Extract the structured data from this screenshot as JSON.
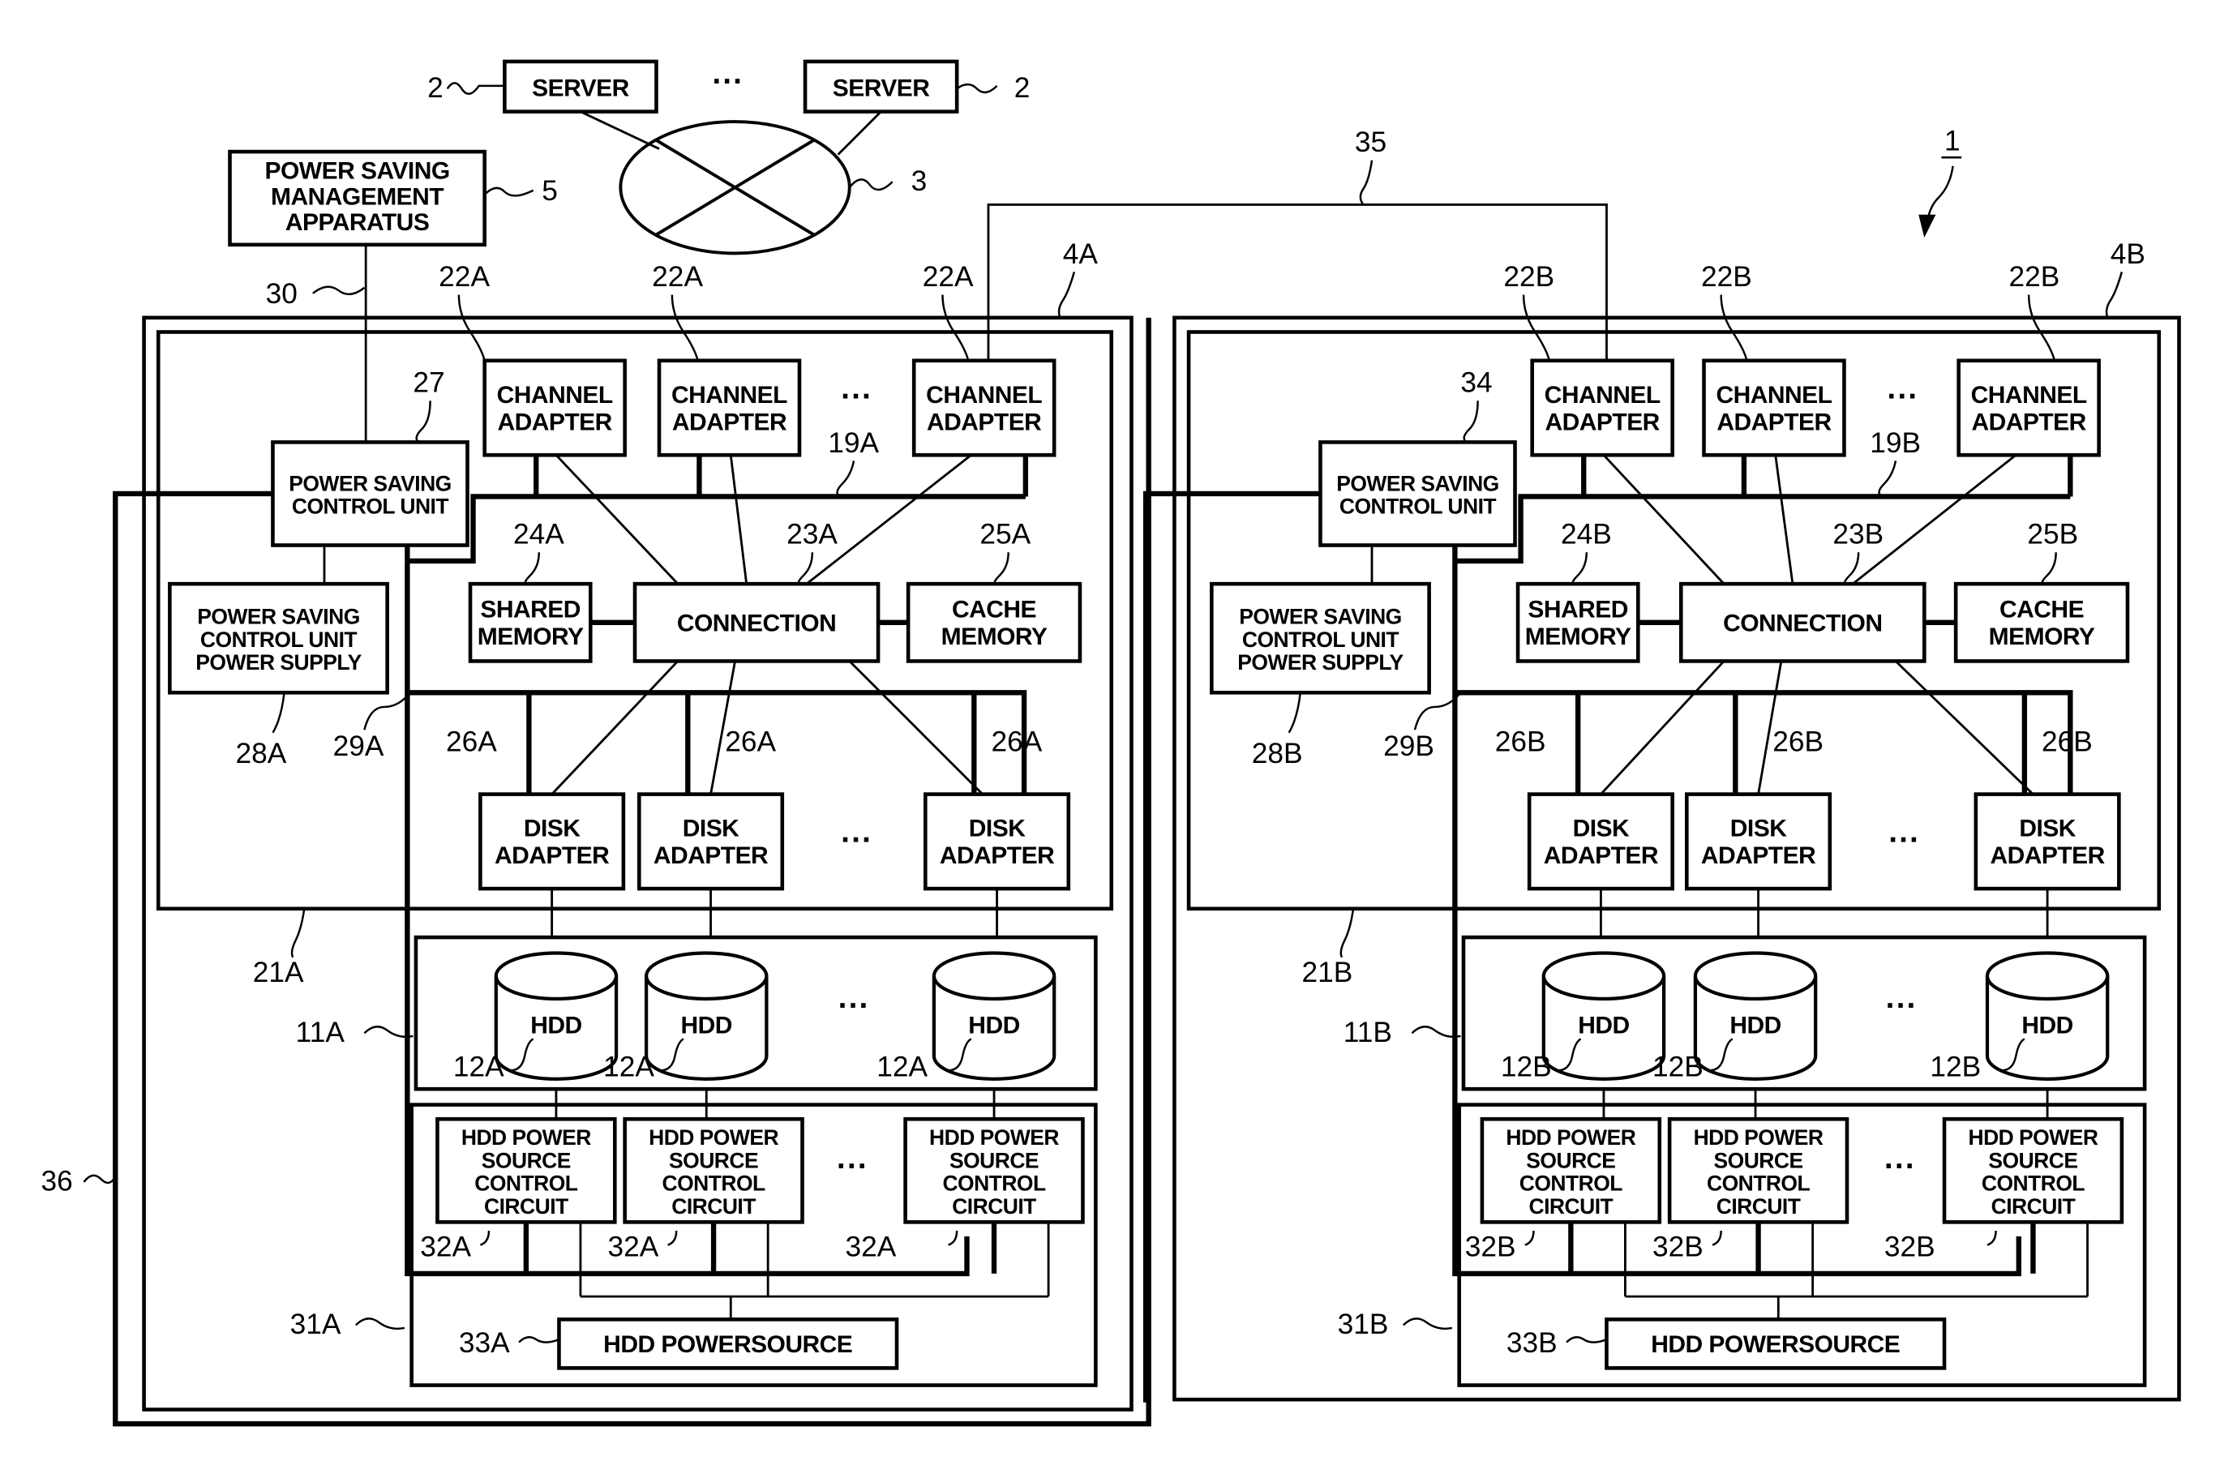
{
  "figure": {
    "system_ref": "1",
    "network": {
      "ref": "3"
    },
    "servers": [
      {
        "label": "SERVER",
        "ref": "2"
      },
      {
        "label": "SERVER",
        "ref": "2"
      }
    ],
    "ellipsis": "···",
    "management": {
      "lines": [
        "POWER SAVING",
        "MANAGEMENT",
        "APPARATUS"
      ],
      "ref": "5",
      "link_ref": "30"
    },
    "inter_link_ref": "35",
    "bus_link_ref": "36",
    "storage": [
      {
        "id": "A",
        "ref": "4A",
        "controller_ref": "21A",
        "channel_adapter": {
          "lines": [
            "CHANNEL",
            "ADAPTER"
          ],
          "ref": "22A"
        },
        "internal_bus_ref": "19A",
        "power_saving_unit": {
          "lines": [
            "POWER SAVING",
            "CONTROL UNIT"
          ],
          "ref": "27"
        },
        "power_supply": {
          "lines": [
            "POWER SAVING",
            "CONTROL UNIT",
            "POWER SUPPLY"
          ],
          "ref": "28A"
        },
        "control_line_ref": "29A",
        "shared_memory": {
          "lines": [
            "SHARED",
            "MEMORY"
          ],
          "ref": "24A"
        },
        "connection": {
          "label": "CONNECTION",
          "ref": "23A"
        },
        "cache_memory": {
          "lines": [
            "CACHE",
            "MEMORY"
          ],
          "ref": "25A"
        },
        "disk_adapter": {
          "lines": [
            "DISK",
            "ADAPTER"
          ],
          "ref": "26A"
        },
        "hdd_group_ref": "11A",
        "hdd": {
          "label": "HDD",
          "ref": "12A"
        },
        "power_circuit_group_ref": "31A",
        "power_circuit": {
          "lines": [
            "HDD POWER",
            "SOURCE",
            "CONTROL",
            "CIRCUIT"
          ],
          "ref": "32A"
        },
        "hdd_powersource": {
          "label": "HDD POWERSOURCE",
          "ref": "33A"
        }
      },
      {
        "id": "B",
        "ref": "4B",
        "controller_ref": "21B",
        "channel_adapter": {
          "lines": [
            "CHANNEL",
            "ADAPTER"
          ],
          "ref": "22B"
        },
        "internal_bus_ref": "19B",
        "power_saving_unit": {
          "lines": [
            "POWER SAVING",
            "CONTROL UNIT"
          ],
          "ref": "34"
        },
        "power_supply": {
          "lines": [
            "POWER SAVING",
            "CONTROL UNIT",
            "POWER SUPPLY"
          ],
          "ref": "28B"
        },
        "control_line_ref": "29B",
        "shared_memory": {
          "lines": [
            "SHARED",
            "MEMORY"
          ],
          "ref": "24B"
        },
        "connection": {
          "label": "CONNECTION",
          "ref": "23B"
        },
        "cache_memory": {
          "lines": [
            "CACHE",
            "MEMORY"
          ],
          "ref": "25B"
        },
        "disk_adapter": {
          "lines": [
            "DISK",
            "ADAPTER"
          ],
          "ref": "26B"
        },
        "hdd_group_ref": "11B",
        "hdd": {
          "label": "HDD",
          "ref": "12B"
        },
        "power_circuit_group_ref": "31B",
        "power_circuit": {
          "lines": [
            "HDD POWER",
            "SOURCE",
            "CONTROL",
            "CIRCUIT"
          ],
          "ref": "32B"
        },
        "hdd_powersource": {
          "label": "HDD POWERSOURCE",
          "ref": "33B"
        }
      }
    ]
  }
}
